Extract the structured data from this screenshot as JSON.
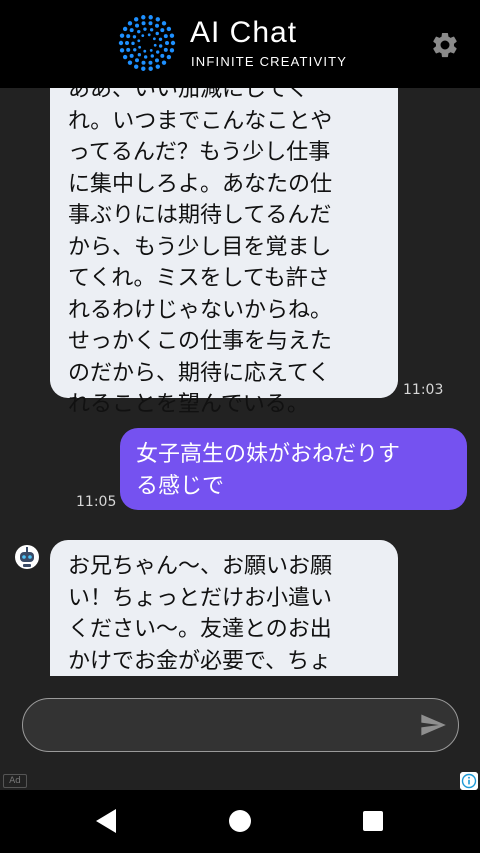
{
  "header": {
    "title": "AI Chat",
    "subtitle": "INFINITE CREATIVITY",
    "logo_icon": "dotted-circle-logo",
    "settings_icon": "gear-icon"
  },
  "messages": [
    {
      "role": "assistant",
      "text": "ああ、いい加減にしてく\nれ。いつまでこんなことや\nってるんだ？もう少し仕事\nに集中しろよ。あなたの仕\n事ぶりには期待してるんだ\nから、もう少し目を覚まし\nてくれ。ミスをしても許さ\nれるわけじゃないからね。\nせっかくこの仕事を与えた\nのだから、期待に応えてく\nれることを望んでいる。",
      "time": "11:03"
    },
    {
      "role": "user",
      "text": "女子高生の妹がおねだりす\nる感じで",
      "time": "11:05"
    },
    {
      "role": "assistant",
      "text": "お兄ちゃん〜、お願いお願\nい！ちょっとだけお小遣い\nください〜。友達とのお出\nかけでお金が必要で、ちょ\nっと遊びたいんです〜。お兄",
      "time": ""
    }
  ],
  "input": {
    "value": "",
    "placeholder": "",
    "send_icon": "send-icon"
  },
  "ad": {
    "label": "Ad",
    "info_icon": "info-icon"
  },
  "nav": {
    "back_icon": "back-triangle-icon",
    "home_icon": "home-circle-icon",
    "recent_icon": "recent-square-icon"
  },
  "colors": {
    "header_bg": "#000000",
    "chat_bg": "#222222",
    "bot_bubble": "#eceff4",
    "user_bubble": "#7552f0",
    "accent_blue": "#1e90ff"
  }
}
